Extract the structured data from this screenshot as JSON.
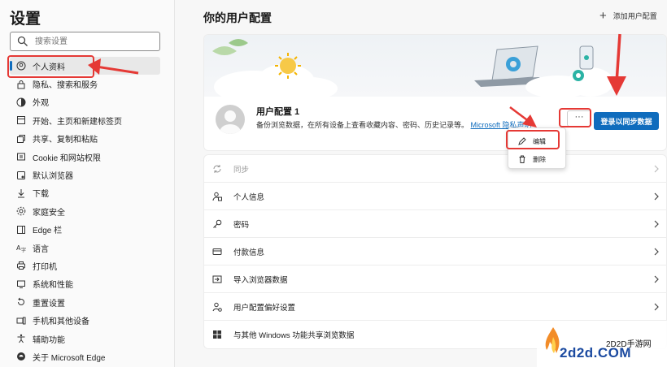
{
  "sidebar": {
    "title": "设置",
    "search_placeholder": "搜索设置",
    "items": [
      {
        "label": "个人资料",
        "icon": "profile-icon"
      },
      {
        "label": "隐私、搜索和服务",
        "icon": "lock-icon"
      },
      {
        "label": "外观",
        "icon": "appearance-icon"
      },
      {
        "label": "开始、主页和新建标签页",
        "icon": "home-icon"
      },
      {
        "label": "共享、复制和粘贴",
        "icon": "share-icon"
      },
      {
        "label": "Cookie 和网站权限",
        "icon": "cookie-icon"
      },
      {
        "label": "默认浏览器",
        "icon": "browser-icon"
      },
      {
        "label": "下载",
        "icon": "download-icon"
      },
      {
        "label": "家庭安全",
        "icon": "family-icon"
      },
      {
        "label": "Edge 栏",
        "icon": "edge-bar-icon"
      },
      {
        "label": "语言",
        "icon": "language-icon"
      },
      {
        "label": "打印机",
        "icon": "printer-icon"
      },
      {
        "label": "系统和性能",
        "icon": "system-icon"
      },
      {
        "label": "重置设置",
        "icon": "reset-icon"
      },
      {
        "label": "手机和其他设备",
        "icon": "phone-icon"
      },
      {
        "label": "辅助功能",
        "icon": "accessibility-icon"
      },
      {
        "label": "关于 Microsoft Edge",
        "icon": "edge-icon"
      }
    ]
  },
  "main": {
    "title": "你的用户配置",
    "add_profile": "添加用户配置",
    "profile": {
      "name": "用户配置 1",
      "description": "备份浏览数据，在所有设备上查看收藏内容、密码、历史记录等。",
      "link": "Microsoft 隐私声明",
      "more": "···",
      "sync_button": "登录以同步数据"
    },
    "menu": {
      "edit": "编辑",
      "delete": "删除"
    },
    "rows": [
      {
        "label": "同步",
        "icon": "sync-icon",
        "disabled": true
      },
      {
        "label": "个人信息",
        "icon": "person-info-icon"
      },
      {
        "label": "密码",
        "icon": "key-icon"
      },
      {
        "label": "付款信息",
        "icon": "card-icon"
      },
      {
        "label": "导入浏览器数据",
        "icon": "import-icon"
      },
      {
        "label": "用户配置偏好设置",
        "icon": "profile-prefs-icon"
      },
      {
        "label": "与其他 Windows 功能共享浏览数据",
        "icon": "windows-icon"
      }
    ]
  },
  "watermark": {
    "top": "2D2D手游网",
    "main": "2d2d.COM"
  },
  "colors": {
    "accent": "#0f6cbd",
    "annotation": "#e53935"
  }
}
